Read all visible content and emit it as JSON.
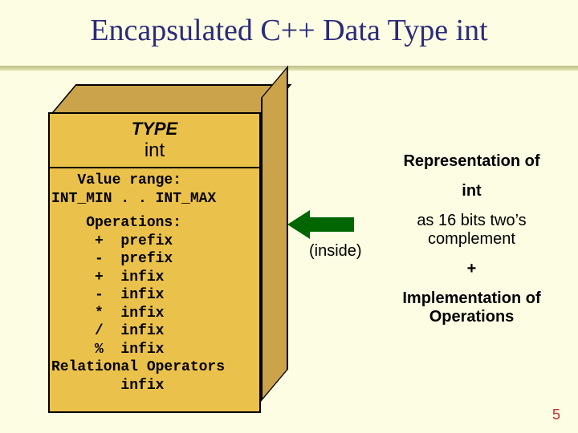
{
  "title": "Encapsulated C++ Data Type int",
  "box": {
    "type_label": "TYPE",
    "int_label": "int",
    "value_range_block": "   Value range:\nINT_MIN . . INT_MAX",
    "operations_block": "    Operations:\n     +  prefix\n     -  prefix\n     +  infix\n     -  infix\n     *  infix\n     /  infix\n     %  infix\nRelational Operators\n        infix"
  },
  "arrow": {
    "inside_label": "(inside)"
  },
  "right": {
    "rep_of": "Representation of",
    "int": "int",
    "as16": "as 16 bits two’s complement",
    "plus": "+",
    "impl": "Implementation of Operations"
  },
  "page_number": "5"
}
